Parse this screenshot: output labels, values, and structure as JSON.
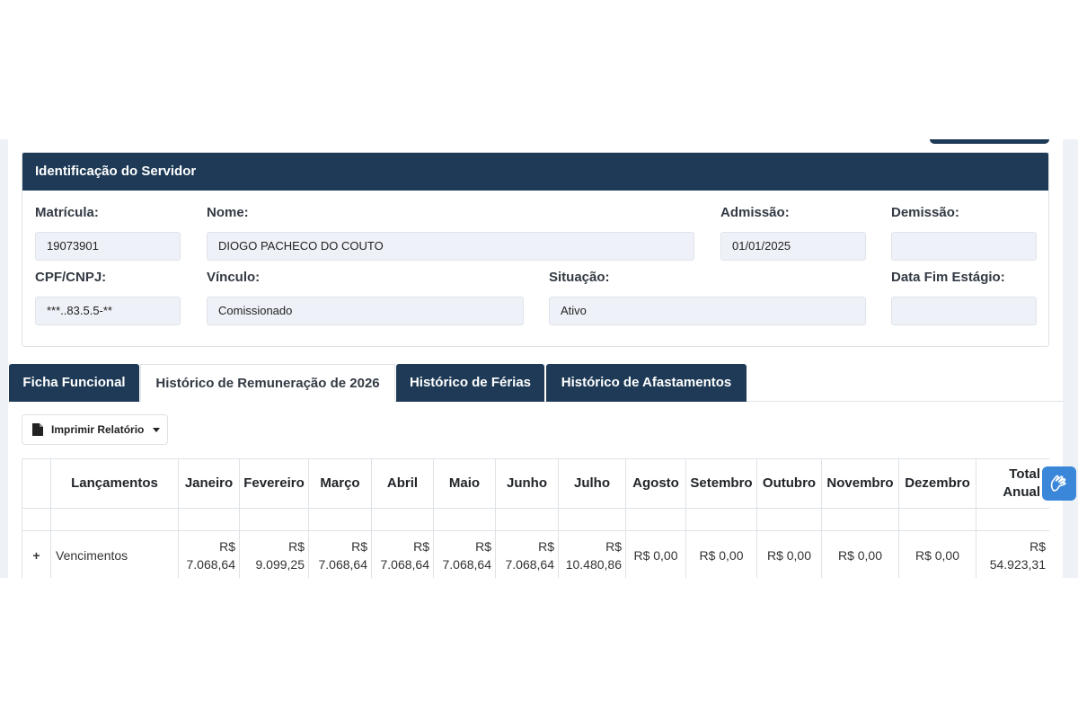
{
  "card": {
    "title": "Identificação do Servidor",
    "fields": {
      "matricula": {
        "label": "Matrícula:",
        "value": "19073901"
      },
      "nome": {
        "label": "Nome:",
        "value": "DIOGO PACHECO DO COUTO"
      },
      "admissao": {
        "label": "Admissão:",
        "value": "01/01/2025"
      },
      "demissao": {
        "label": "Demissão:",
        "value": ""
      },
      "cpf": {
        "label": "CPF/CNPJ:",
        "value": "***..83.5.5-**"
      },
      "vinculo": {
        "label": "Vínculo:",
        "value": "Comissionado"
      },
      "situacao": {
        "label": "Situação:",
        "value": "Ativo"
      },
      "data_fim_estagio": {
        "label": "Data Fim Estágio:",
        "value": ""
      }
    }
  },
  "tabs": [
    {
      "label": "Ficha Funcional"
    },
    {
      "label": "Histórico de Remuneração de 2026"
    },
    {
      "label": "Histórico de Férias"
    },
    {
      "label": "Histórico de Afastamentos"
    }
  ],
  "print_button": {
    "label": "Imprimir Relatório"
  },
  "table": {
    "headers": [
      "Lançamentos",
      "Janeiro",
      "Fevereiro",
      "Março",
      "Abril",
      "Maio",
      "Junho",
      "Julho",
      "Agosto",
      "Setembro",
      "Outubro",
      "Novembro",
      "Dezembro",
      "Total Anual"
    ],
    "rows": [
      {
        "expand": "+",
        "label": "Vencimentos",
        "values": [
          "R$ 7.068,64",
          "R$ 9.099,25",
          "R$ 7.068,64",
          "R$ 7.068,64",
          "R$ 7.068,64",
          "R$ 7.068,64",
          "R$ 10.480,86",
          "R$ 0,00",
          "R$ 0,00",
          "R$ 0,00",
          "R$ 0,00",
          "R$ 0,00",
          "R$ 54.923,31"
        ]
      }
    ]
  },
  "colors": {
    "primary": "#1e3a56",
    "field_bg": "#eef1f7",
    "accessibility": "#3a86d8"
  },
  "icons": {
    "print": "document-icon",
    "dropdown": "caret-down-icon",
    "accessibility": "sign-language-hands-icon"
  }
}
